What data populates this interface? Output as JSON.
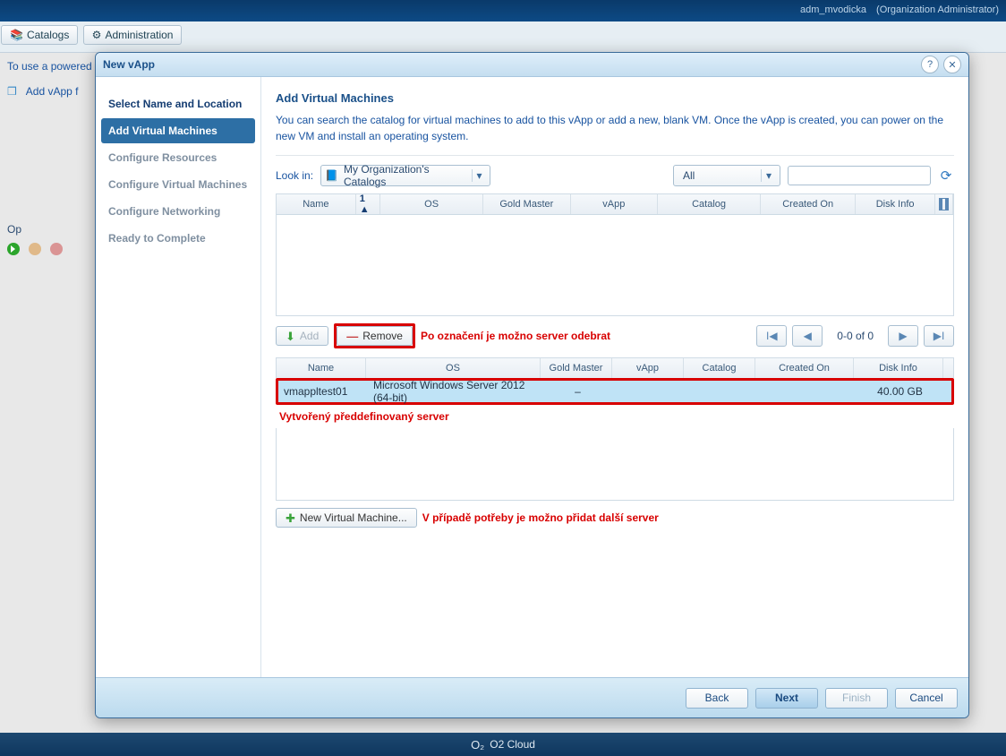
{
  "header": {
    "user": "adm_mvodicka",
    "role": "(Organization Administrator)"
  },
  "bg_tabs": {
    "catalogs": "Catalogs",
    "admin": "Administration"
  },
  "bg_hint": "To use a powered on v",
  "bg_action": "Add vApp f",
  "bg_ops": "Op",
  "modal": {
    "title": "New vApp",
    "steps": {
      "s1": "Select Name and Location",
      "s2": "Add Virtual Machines",
      "s3": "Configure Resources",
      "s4": "Configure Virtual Machines",
      "s5": "Configure Networking",
      "s6": "Ready to Complete"
    },
    "panel": {
      "title": "Add Virtual Machines",
      "desc": "You can search the catalog for virtual machines to add to this vApp or add a new, blank VM. Once the vApp is created, you can power on the new VM and install an operating system.",
      "look_in_label": "Look in:",
      "look_in_value": "My Organization's Catalogs",
      "filter_all": "All"
    },
    "grid1": {
      "cols": {
        "name": "Name",
        "sort": "1 ▲",
        "os": "OS",
        "gold": "Gold Master",
        "vapp": "vApp",
        "catalog": "Catalog",
        "created": "Created On",
        "disk": "Disk Info"
      },
      "pager": "0-0 of 0"
    },
    "buttons": {
      "add": "Add",
      "remove": "Remove",
      "new_vm": "New Virtual Machine..."
    },
    "annot": {
      "remove": "Po označení je možno server odebrat",
      "created": "Vytvořený předdefinovaný server",
      "newvm": "V případě potřeby je možno přidat další server"
    },
    "grid2": {
      "cols": {
        "name": "Name",
        "os": "OS",
        "gold": "Gold Master",
        "vapp": "vApp",
        "catalog": "Catalog",
        "created": "Created On",
        "disk": "Disk Info"
      },
      "row": {
        "name": "vmappltest01",
        "os": "Microsoft Windows Server 2012 (64-bit)",
        "gold": "–",
        "vapp": "",
        "catalog": "",
        "created": "",
        "disk": "40.00 GB"
      }
    },
    "footer": {
      "back": "Back",
      "next": "Next",
      "finish": "Finish",
      "cancel": "Cancel"
    }
  },
  "status": "O2 Cloud"
}
